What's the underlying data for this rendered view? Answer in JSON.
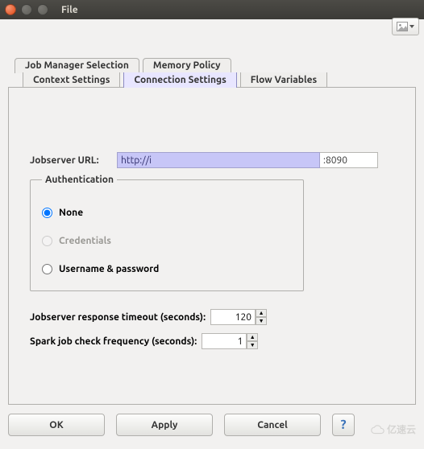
{
  "window": {
    "title": "File"
  },
  "tabs_row1": [
    {
      "label": "Job Manager Selection"
    },
    {
      "label": "Memory Policy"
    }
  ],
  "tabs_row2": [
    {
      "label": "Context Settings"
    },
    {
      "label": "Connection Settings"
    },
    {
      "label": "Flow Variables"
    }
  ],
  "active_tab_row": 2,
  "active_tab_index": 1,
  "form": {
    "url_label": "Jobserver URL:",
    "url_value": "http://i",
    "url_port": ":8090",
    "auth_legend": "Authentication",
    "auth_options": {
      "none": "None",
      "credentials": "Credentials",
      "userpass": "Username & password"
    },
    "auth_selected": "none",
    "auth_disabled": [
      "credentials"
    ],
    "timeout_label": "Jobserver response timeout (seconds):",
    "timeout_value": "120",
    "freq_label": "Spark job check frequency (seconds):",
    "freq_value": "1"
  },
  "buttons": {
    "ok": "OK",
    "apply": "Apply",
    "cancel": "Cancel",
    "help": "?"
  },
  "watermark": "亿速云"
}
